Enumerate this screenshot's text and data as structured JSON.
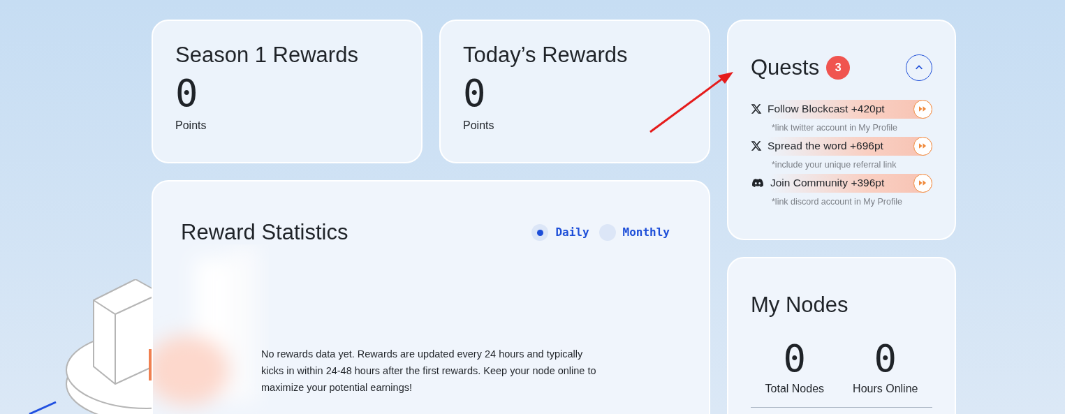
{
  "summary_cards": [
    {
      "title": "Season 1 Rewards",
      "value": "0",
      "unit": "Points"
    },
    {
      "title": "Today’s Rewards",
      "value": "0",
      "unit": "Points"
    }
  ],
  "reward_statistics": {
    "title": "Reward Statistics",
    "periods": [
      {
        "label": "Daily",
        "selected": true
      },
      {
        "label": "Monthly",
        "selected": false
      }
    ],
    "empty_message": "No rewards data yet. Rewards are updated every 24 hours and typically kicks in within 24-48 hours after the first rewards. Keep your node online to maximize your potential earnings!"
  },
  "quests": {
    "title": "Quests",
    "count": "3",
    "expanded": true,
    "items": [
      {
        "kind": "x",
        "label": "Follow Blockcast +420pt",
        "note": "*link twitter account in My Profile"
      },
      {
        "kind": "x",
        "label": "Spread the word +696pt",
        "note": "*include your unique referral link"
      },
      {
        "kind": "discord",
        "label": "Join Community +396pt",
        "note": "*link discord account in My Profile"
      }
    ]
  },
  "my_nodes": {
    "title": "My Nodes",
    "stats": [
      {
        "value": "0",
        "label": "Total Nodes"
      },
      {
        "value": "0",
        "label": "Hours Online"
      }
    ]
  }
}
